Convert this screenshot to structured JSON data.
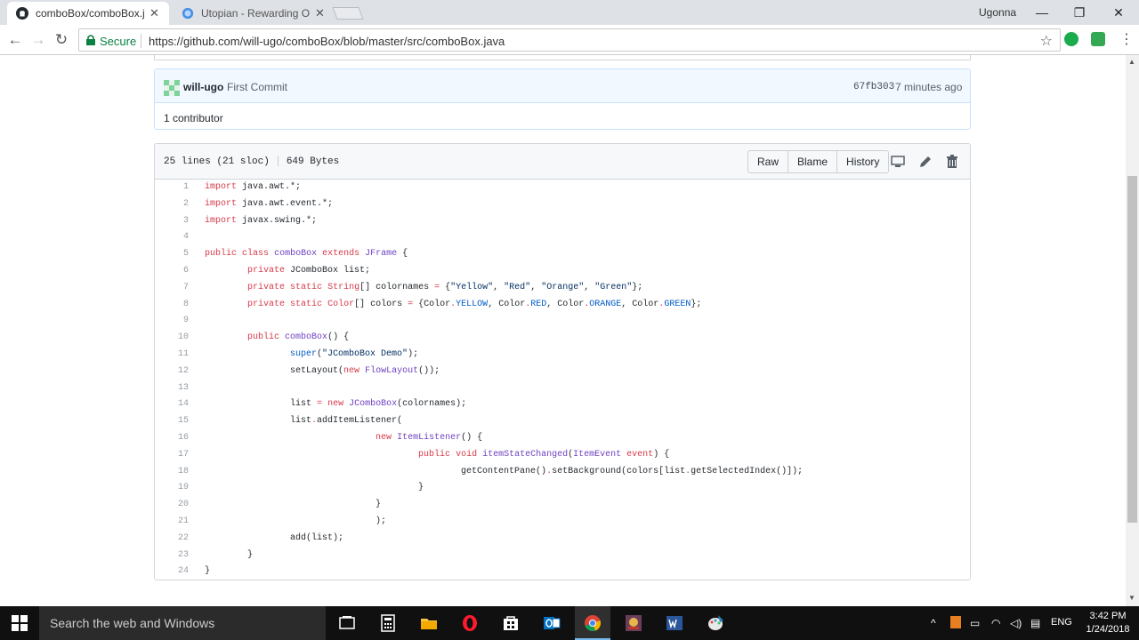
{
  "browser": {
    "tabs": [
      {
        "title": "comboBox/comboBox.ja",
        "active": true
      },
      {
        "title": "Utopian - Rewarding Op",
        "active": false
      }
    ],
    "user": "Ugonna",
    "secure_label": "Secure",
    "url": "https://github.com/will-ugo/comboBox/blob/master/src/comboBox.java"
  },
  "commit": {
    "author": "will-ugo",
    "message": "First Commit",
    "sha": "67fb303",
    "time": "7 minutes ago",
    "contributors": "1 contributor"
  },
  "file": {
    "lines_info": "25 lines (21 sloc)",
    "size": "649 Bytes",
    "buttons": {
      "raw": "Raw",
      "blame": "Blame",
      "history": "History"
    }
  },
  "code_lines": [
    [
      [
        "k",
        "import"
      ],
      [
        "p",
        " java.awt.*;"
      ]
    ],
    [
      [
        "k",
        "import"
      ],
      [
        "p",
        " java.awt.event.*;"
      ]
    ],
    [
      [
        "k",
        "import"
      ],
      [
        "p",
        " javax.swing.*;"
      ]
    ],
    [],
    [
      [
        "k",
        "public"
      ],
      [
        "p",
        " "
      ],
      [
        "k",
        "class"
      ],
      [
        "p",
        " "
      ],
      [
        "t",
        "comboBox"
      ],
      [
        "p",
        " "
      ],
      [
        "k",
        "extends"
      ],
      [
        "p",
        " "
      ],
      [
        "t",
        "JFrame"
      ],
      [
        "p",
        " {"
      ]
    ],
    [
      [
        "p",
        "        "
      ],
      [
        "k",
        "private"
      ],
      [
        "p",
        " JComboBox list;"
      ]
    ],
    [
      [
        "p",
        "        "
      ],
      [
        "k",
        "private"
      ],
      [
        "p",
        " "
      ],
      [
        "k",
        "static"
      ],
      [
        "p",
        " "
      ],
      [
        "k",
        "String"
      ],
      [
        "p",
        "[] colornames "
      ],
      [
        "k",
        "="
      ],
      [
        "p",
        " {"
      ],
      [
        "s",
        "\"Yellow\""
      ],
      [
        "p",
        ", "
      ],
      [
        "s",
        "\"Red\""
      ],
      [
        "p",
        ", "
      ],
      [
        "s",
        "\"Orange\""
      ],
      [
        "p",
        ", "
      ],
      [
        "s",
        "\"Green\""
      ],
      [
        "p",
        "};"
      ]
    ],
    [
      [
        "p",
        "        "
      ],
      [
        "k",
        "private"
      ],
      [
        "p",
        " "
      ],
      [
        "k",
        "static"
      ],
      [
        "p",
        " "
      ],
      [
        "k",
        "Color"
      ],
      [
        "p",
        "[] colors "
      ],
      [
        "k",
        "="
      ],
      [
        "p",
        " {"
      ],
      [
        "p",
        "Color"
      ],
      [
        "k",
        "."
      ],
      [
        "c",
        "YELLOW"
      ],
      [
        "p",
        ", Color"
      ],
      [
        "k",
        "."
      ],
      [
        "c",
        "RED"
      ],
      [
        "p",
        ", Color"
      ],
      [
        "k",
        "."
      ],
      [
        "c",
        "ORANGE"
      ],
      [
        "p",
        ", Color"
      ],
      [
        "k",
        "."
      ],
      [
        "c",
        "GREEN"
      ],
      [
        "p",
        "};"
      ]
    ],
    [],
    [
      [
        "p",
        "        "
      ],
      [
        "k",
        "public"
      ],
      [
        "p",
        " "
      ],
      [
        "t",
        "comboBox"
      ],
      [
        "p",
        "() {"
      ]
    ],
    [
      [
        "p",
        "                "
      ],
      [
        "c",
        "super"
      ],
      [
        "p",
        "("
      ],
      [
        "s",
        "\"JComboBox Demo\""
      ],
      [
        "p",
        ");"
      ]
    ],
    [
      [
        "p",
        "                setLayout("
      ],
      [
        "k",
        "new"
      ],
      [
        "p",
        " "
      ],
      [
        "t",
        "FlowLayout"
      ],
      [
        "p",
        "());"
      ]
    ],
    [],
    [
      [
        "p",
        "                list "
      ],
      [
        "k",
        "="
      ],
      [
        "p",
        " "
      ],
      [
        "k",
        "new"
      ],
      [
        "p",
        " "
      ],
      [
        "t",
        "JComboBox"
      ],
      [
        "p",
        "(colornames);"
      ]
    ],
    [
      [
        "p",
        "                list"
      ],
      [
        "k",
        "."
      ],
      [
        "p",
        "addItemListener("
      ]
    ],
    [
      [
        "p",
        "                                "
      ],
      [
        "k",
        "new"
      ],
      [
        "p",
        " "
      ],
      [
        "t",
        "ItemListener"
      ],
      [
        "p",
        "() {"
      ]
    ],
    [
      [
        "p",
        "                                        "
      ],
      [
        "k",
        "public"
      ],
      [
        "p",
        " "
      ],
      [
        "k",
        "void"
      ],
      [
        "p",
        " "
      ],
      [
        "t",
        "itemStateChanged"
      ],
      [
        "p",
        "("
      ],
      [
        "t",
        "ItemEvent"
      ],
      [
        "p",
        " "
      ],
      [
        "k",
        "event"
      ],
      [
        "p",
        ") {"
      ]
    ],
    [
      [
        "p",
        "                                                getContentPane()"
      ],
      [
        "k",
        "."
      ],
      [
        "p",
        "setBackground(colors[list"
      ],
      [
        "k",
        "."
      ],
      [
        "p",
        "getSelectedIndex()]);"
      ]
    ],
    [
      [
        "p",
        "                                        }"
      ]
    ],
    [
      [
        "p",
        "                                }"
      ]
    ],
    [
      [
        "p",
        "                                );"
      ]
    ],
    [
      [
        "p",
        "                add(list);"
      ]
    ],
    [
      [
        "p",
        "        }"
      ]
    ],
    [
      [
        "p",
        "}"
      ]
    ]
  ],
  "taskbar": {
    "search_placeholder": "Search the web and Windows",
    "language": "ENG",
    "time": "3:42 PM",
    "date": "1/24/2018"
  }
}
